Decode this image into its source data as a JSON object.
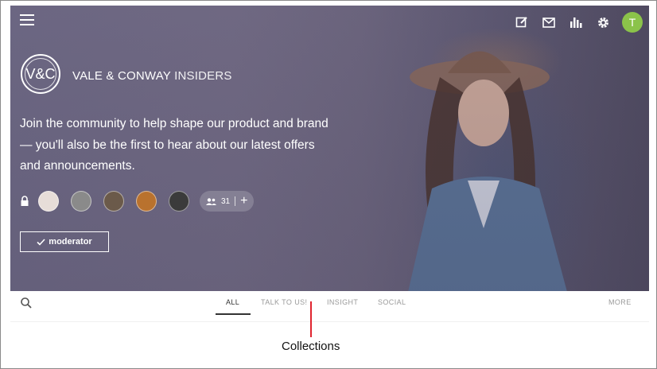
{
  "header": {
    "brand_logo": "V&C",
    "brand_name": "VALE & CONWAY",
    "brand_suffix": "INSIDERS",
    "user_initial": "T",
    "icons": [
      "menu-icon",
      "edit-icon",
      "mail-icon",
      "bar-chart-icon",
      "gear-icon"
    ]
  },
  "hero": {
    "tagline": "Join the community to help shape our product and brand — you'll also be the first to hear about our latest offers and announcements.",
    "member_count": "31",
    "moderator_label": "moderator"
  },
  "tabs": {
    "all": "ALL",
    "talk": "TALK TO US!",
    "insight": "INSIGHT",
    "social": "SOCIAL",
    "more": "MORE"
  },
  "annotation": {
    "label": "Collections"
  },
  "colors": {
    "avatar_bg": "#8bc34a",
    "callout": "#e0242f",
    "hero_overlay": "#6f6a86"
  }
}
